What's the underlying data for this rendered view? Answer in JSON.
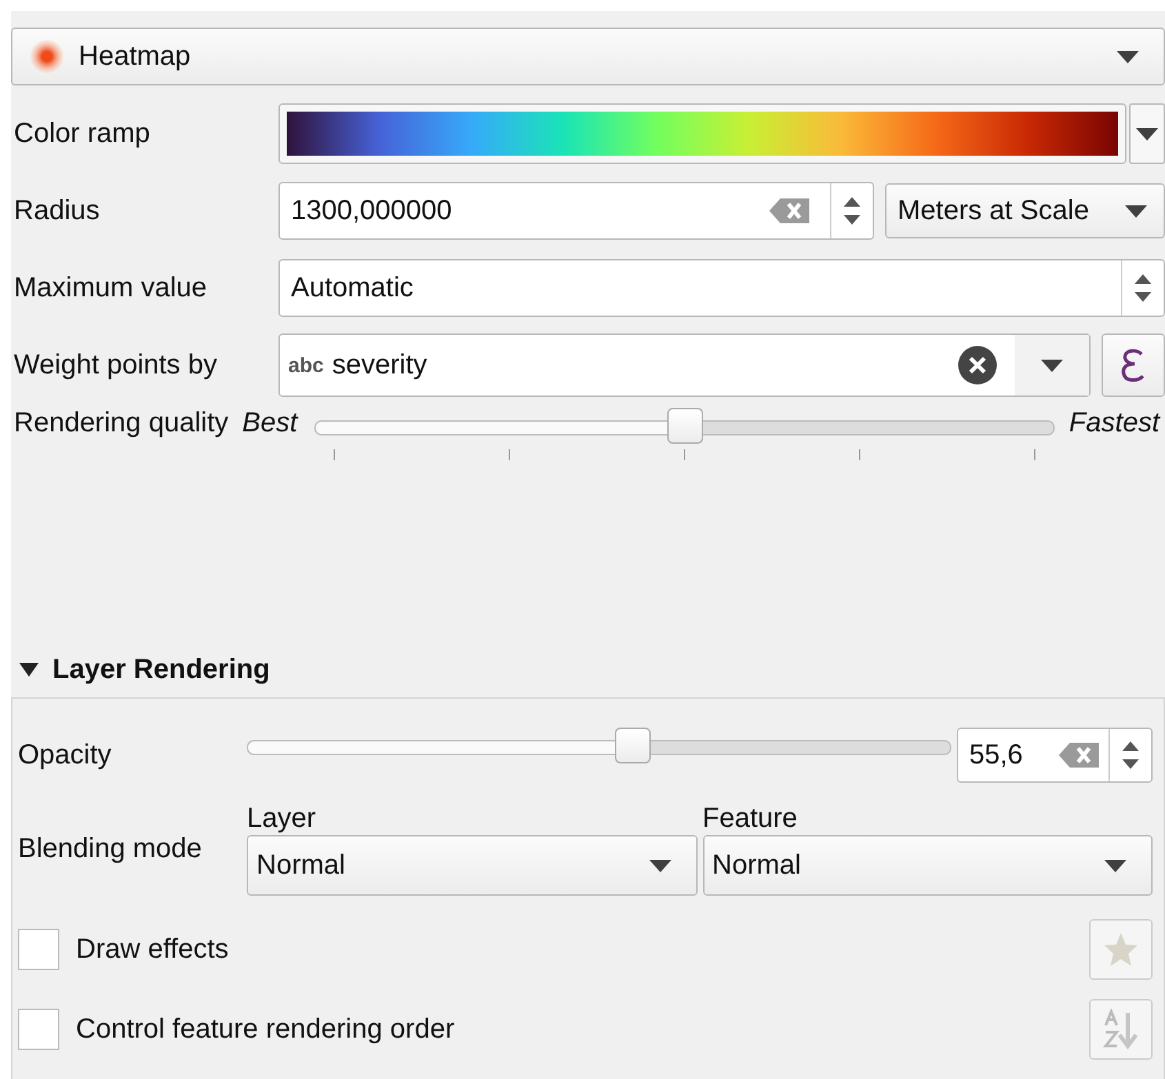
{
  "renderer": {
    "label": "Heatmap"
  },
  "color_ramp": {
    "label": "Color ramp"
  },
  "radius": {
    "label": "Radius",
    "value": "1300,000000",
    "unit": "Meters at Scale"
  },
  "maximum_value": {
    "label": "Maximum value",
    "value": "Automatic"
  },
  "weight_points_by": {
    "label": "Weight points by",
    "type_tag": "abc",
    "value": "severity"
  },
  "rendering_quality": {
    "label": "Rendering quality",
    "min_label": "Best",
    "max_label": "Fastest",
    "level": 0.5
  },
  "layer_rendering": {
    "title": "Layer Rendering",
    "expanded": true,
    "opacity": {
      "label": "Opacity",
      "level": 0.55,
      "value": "55,6"
    },
    "blending_mode": {
      "label": "Blending mode",
      "layer_label": "Layer",
      "layer_value": "Normal",
      "feature_label": "Feature",
      "feature_value": "Normal"
    },
    "checkboxes": [
      {
        "label": "Draw effects",
        "checked": false,
        "kind": "star"
      },
      {
        "label": "Control feature rendering order",
        "checked": false,
        "kind": "sort"
      }
    ]
  }
}
